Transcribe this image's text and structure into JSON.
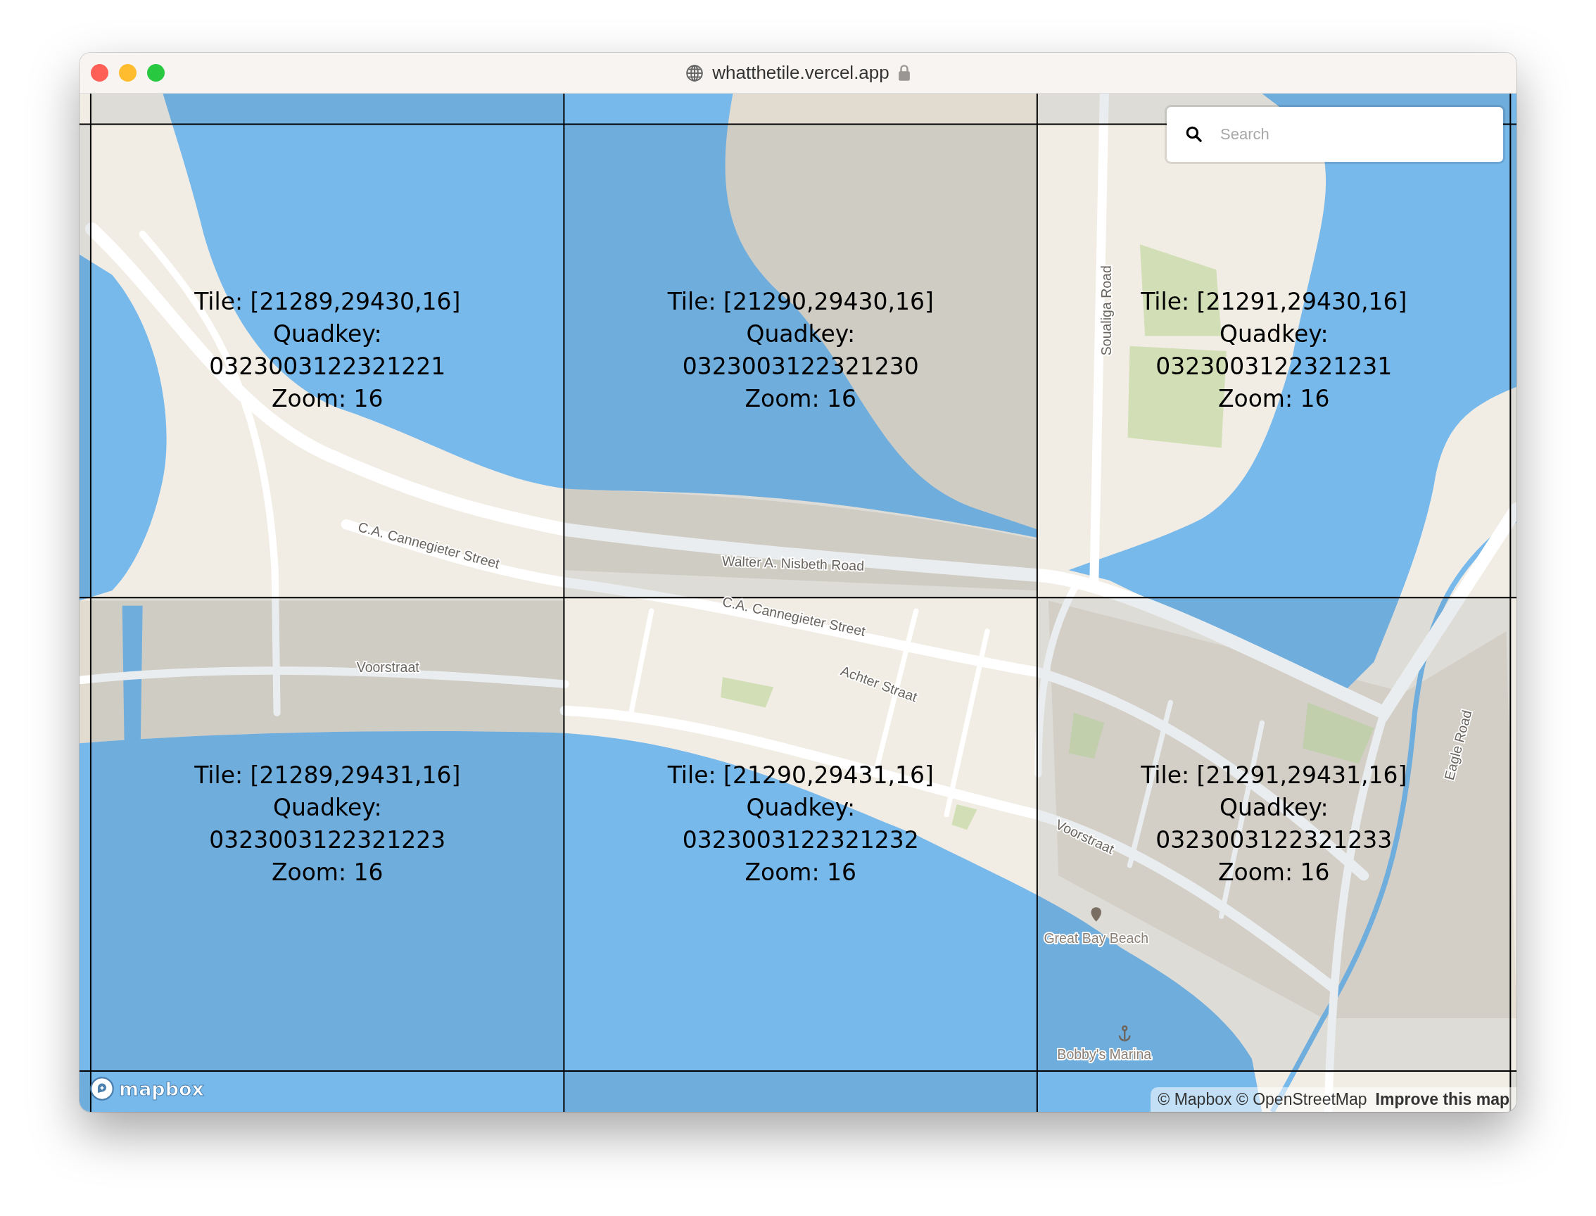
{
  "window": {
    "url": "whatthetile.vercel.app"
  },
  "search": {
    "placeholder": "Search"
  },
  "tiles": [
    {
      "tile": "Tile: [21289,29430,16]",
      "quadkey_label": "Quadkey:",
      "quadkey": "0323003122321221",
      "zoom": "Zoom: 16"
    },
    {
      "tile": "Tile: [21290,29430,16]",
      "quadkey_label": "Quadkey:",
      "quadkey": "0323003122321230",
      "zoom": "Zoom: 16"
    },
    {
      "tile": "Tile: [21291,29430,16]",
      "quadkey_label": "Quadkey:",
      "quadkey": "0323003122321231",
      "zoom": "Zoom: 16"
    },
    {
      "tile": "Tile: [21289,29431,16]",
      "quadkey_label": "Quadkey:",
      "quadkey": "0323003122321223",
      "zoom": "Zoom: 16"
    },
    {
      "tile": "Tile: [21290,29431,16]",
      "quadkey_label": "Quadkey:",
      "quadkey": "0323003122321232",
      "zoom": "Zoom: 16"
    },
    {
      "tile": "Tile: [21291,29431,16]",
      "quadkey_label": "Quadkey:",
      "quadkey": "0323003122321233",
      "zoom": "Zoom: 16"
    }
  ],
  "map_labels": [
    {
      "text": "C.A. Cannegieter Street",
      "kind": "street"
    },
    {
      "text": "Walter A. Nisbeth Road",
      "kind": "street"
    },
    {
      "text": "C.A. Cannegieter Street",
      "kind": "street"
    },
    {
      "text": "Voorstraat",
      "kind": "street"
    },
    {
      "text": "Achter Straat",
      "kind": "street"
    },
    {
      "text": "Soualiga Road",
      "kind": "street"
    },
    {
      "text": "Eagle Road",
      "kind": "street"
    },
    {
      "text": "Voorstraat",
      "kind": "street"
    },
    {
      "text": "Great Bay Beach",
      "kind": "beach"
    },
    {
      "text": "Bobby's Marina",
      "kind": "marina"
    }
  ],
  "logo": {
    "text": "mapbox"
  },
  "attribution": {
    "text": "© Mapbox © OpenStreetMap",
    "link": "Improve this map"
  }
}
